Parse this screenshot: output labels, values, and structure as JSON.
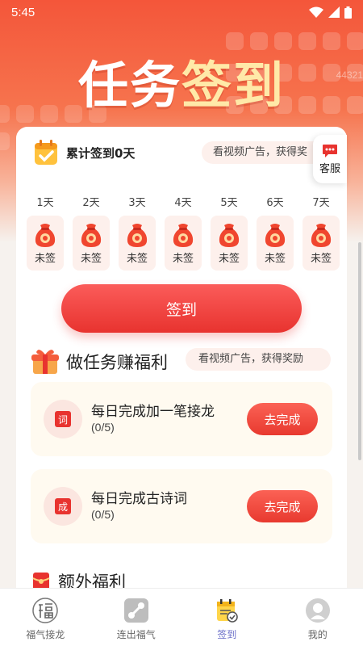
{
  "status_bar": {
    "time": "5:45"
  },
  "hero": {
    "title_main": "任务",
    "title_accent": "签到",
    "watermark": "44321"
  },
  "signin": {
    "summary": "累计签到0天",
    "ad_tip": "看视频广告，获得奖",
    "service_label": "客服",
    "days": [
      {
        "label": "1天",
        "status": "未签"
      },
      {
        "label": "2天",
        "status": "未签"
      },
      {
        "label": "3天",
        "status": "未签"
      },
      {
        "label": "4天",
        "status": "未签"
      },
      {
        "label": "5天",
        "status": "未签"
      },
      {
        "label": "6天",
        "status": "未签"
      },
      {
        "label": "7天",
        "status": "未签"
      }
    ],
    "button_label": "签到"
  },
  "tasks_section": {
    "title": "做任务赚福利",
    "ad_tip": "看视频广告，获得奖励",
    "tasks": [
      {
        "icon_char": "词",
        "name": "每日完成加一笔接龙",
        "progress": "(0/5)",
        "button": "去完成"
      },
      {
        "icon_char": "成",
        "name": "每日完成古诗词",
        "progress": "(0/5)",
        "button": "去完成"
      }
    ]
  },
  "extra_section": {
    "title": "额外福利"
  },
  "bottom_nav": {
    "items": [
      {
        "label": "福气接龙",
        "icon": "fu-icon"
      },
      {
        "label": "连出福气",
        "icon": "link-icon"
      },
      {
        "label": "签到",
        "icon": "calendar-check-icon",
        "active": true
      },
      {
        "label": "我的",
        "icon": "profile-icon"
      }
    ]
  },
  "colors": {
    "brand_red": "#e8332f",
    "active_nav": "#6a6ec8",
    "hero_top": "#f4563a"
  }
}
